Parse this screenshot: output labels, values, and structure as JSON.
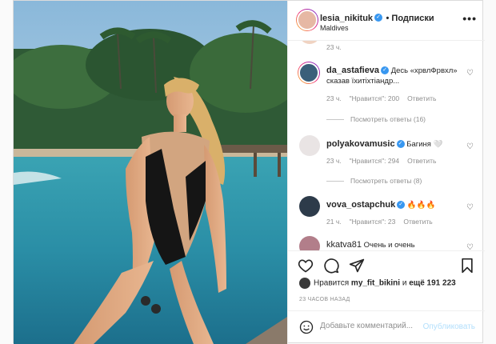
{
  "header": {
    "username": "lesia_nikituk",
    "follow_label": "• Подписки",
    "location": "Maldives",
    "more": "•••"
  },
  "comments": [
    {
      "time": "23 ч."
    },
    {
      "username": "da_astafieva",
      "text": "Десь «хрвлФрвхл» сказав їхитіхтіандр...",
      "time": "23 ч.",
      "likes": "\"Нравится\": 200",
      "reply": "Ответить",
      "replies": "Посмотреть ответы (16)"
    },
    {
      "username": "polyakovamusic",
      "text": "Багиня 🤍",
      "time": "23 ч.",
      "likes": "\"Нравится\": 294",
      "reply": "Ответить",
      "replies": "Посмотреть ответы (8)"
    },
    {
      "username": "vova_ostapchuk",
      "text": "🔥🔥🔥",
      "time": "21 ч.",
      "likes": "\"Нравится\": 23",
      "reply": "Ответить"
    },
    {
      "username": "kkatva81",
      "text": "Очень и очень"
    }
  ],
  "likes": {
    "prefix": "Нравится",
    "user": "my_fit_bikini",
    "middle": "и",
    "rest": "ещё 191 223"
  },
  "posted_ago": "23 ЧАСОВ НАЗАД",
  "add_comment": {
    "placeholder": "Добавьте комментарий...",
    "publish_label": "Опубликовать"
  },
  "icons": [
    "heart-icon",
    "comment-icon",
    "share-icon",
    "bookmark-icon",
    "emoji-icon"
  ],
  "colors": {
    "link": "#3897f0",
    "publish_disabled": "#b2dffc",
    "muted": "#8e8e8e"
  }
}
